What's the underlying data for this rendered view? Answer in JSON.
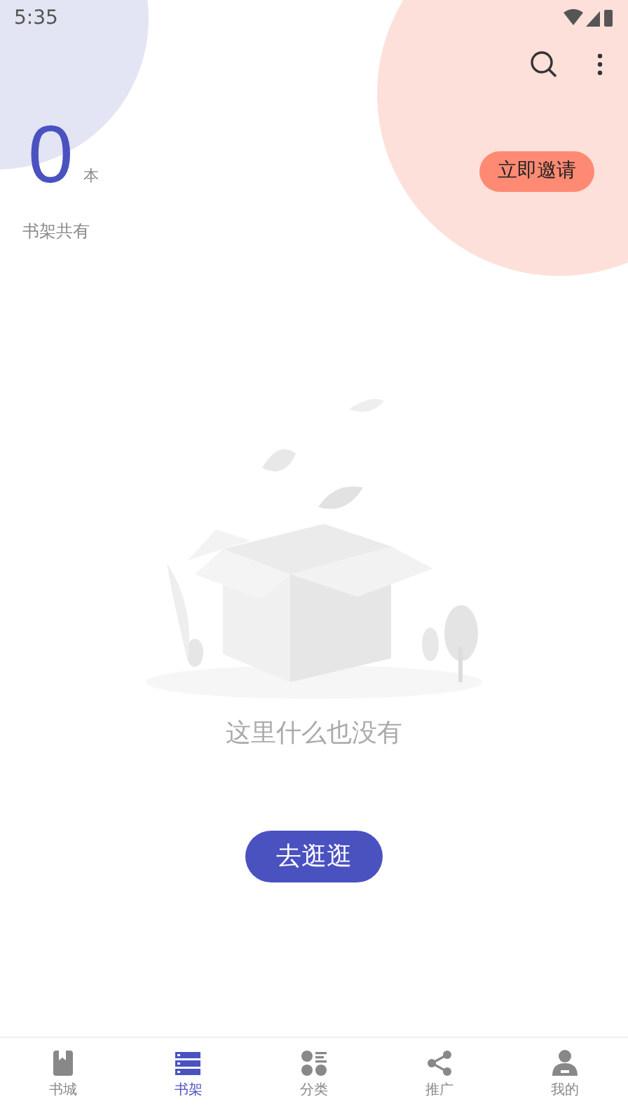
{
  "status_bar": {
    "time": "5:35"
  },
  "summary": {
    "count": "0",
    "unit": "本",
    "caption": "书架共有",
    "invite_button": "立即邀请"
  },
  "empty_state": {
    "message": "这里什么也没有",
    "action_button": "去逛逛"
  },
  "bottom_nav": [
    {
      "label": "书城",
      "selected": false
    },
    {
      "label": "书架",
      "selected": true
    },
    {
      "label": "分类",
      "selected": false
    },
    {
      "label": "推广",
      "selected": false
    },
    {
      "label": "我的",
      "selected": false
    }
  ]
}
